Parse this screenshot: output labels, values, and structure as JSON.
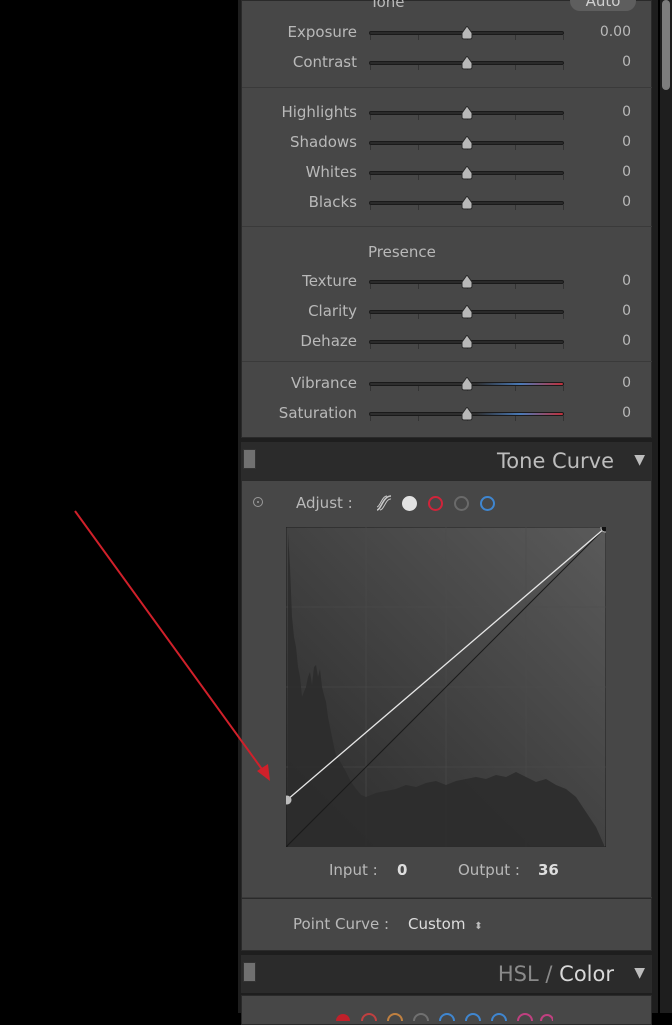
{
  "basic": {
    "tone_label": "Tone",
    "auto_button": "Auto",
    "sliders_a": [
      {
        "label": "Exposure",
        "value": "0.00",
        "position": 0.5
      },
      {
        "label": "Contrast",
        "value": "0",
        "position": 0.5
      }
    ],
    "sliders_b": [
      {
        "label": "Highlights",
        "value": "0",
        "position": 0.5
      },
      {
        "label": "Shadows",
        "value": "0",
        "position": 0.5
      },
      {
        "label": "Whites",
        "value": "0",
        "position": 0.5
      },
      {
        "label": "Blacks",
        "value": "0",
        "position": 0.5
      }
    ],
    "presence_label": "Presence",
    "sliders_c": [
      {
        "label": "Texture",
        "value": "0",
        "position": 0.5
      },
      {
        "label": "Clarity",
        "value": "0",
        "position": 0.5
      },
      {
        "label": "Dehaze",
        "value": "0",
        "position": 0.5
      }
    ],
    "sliders_d": [
      {
        "label": "Vibrance",
        "value": "0",
        "position": 0.5
      },
      {
        "label": "Saturation",
        "value": "0",
        "position": 0.5
      }
    ]
  },
  "tone_curve": {
    "title": "Tone Curve",
    "adjust_label": "Adjust :",
    "channels": [
      "parametric-icon",
      "rgb-white",
      "red",
      "green",
      "blue"
    ],
    "channel_colors": {
      "white": "#e0e0e0",
      "red": "#d0243a",
      "green": "#6a6a6a",
      "blue": "#3f86d0"
    },
    "input_label": "Input :",
    "input_value": "0",
    "output_label": "Output :",
    "output_value": "36",
    "point_curve_label": "Point Curve :",
    "point_curve_value": "Custom",
    "curve_points": [
      [
        0,
        36
      ],
      [
        255,
        255
      ]
    ]
  },
  "hsl": {
    "title_left": "HSL",
    "separator": "/",
    "title_right": "Color"
  },
  "annotation": {
    "arrow_color": "#d0202a"
  }
}
